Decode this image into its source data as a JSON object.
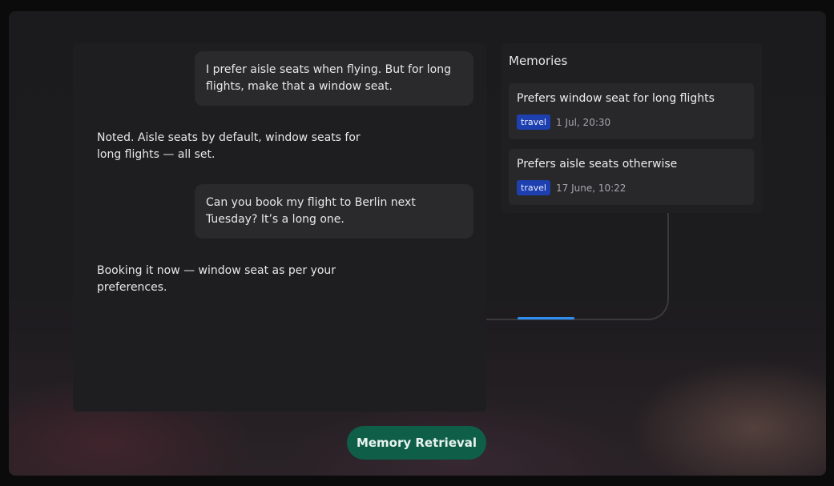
{
  "conversation": {
    "messages": [
      {
        "role": "user",
        "text": "I prefer aisle seats when flying. But for long flights, make that a window seat."
      },
      {
        "role": "assistant",
        "text": "Noted. Aisle seats by default, window seats for long flights — all set."
      },
      {
        "role": "user",
        "text": "Can you book my flight to Berlin next Tuesday? It’s a long one."
      },
      {
        "role": "assistant",
        "text": "Booking it now — window seat as per your preferences."
      }
    ]
  },
  "memories": {
    "title": "Memories",
    "items": [
      {
        "text": "Prefers window seat for long flights",
        "tag": "travel",
        "time": "1 Jul, 20:30"
      },
      {
        "text": "Prefers aisle seats otherwise",
        "tag": "travel",
        "time": "17 June, 10:22"
      }
    ]
  },
  "badge": {
    "label": "Memory Retrieval"
  },
  "colors": {
    "tag_bg": "#1e3fb0",
    "badge_bg": "#0e5e48",
    "progress": "#2f8df0"
  }
}
